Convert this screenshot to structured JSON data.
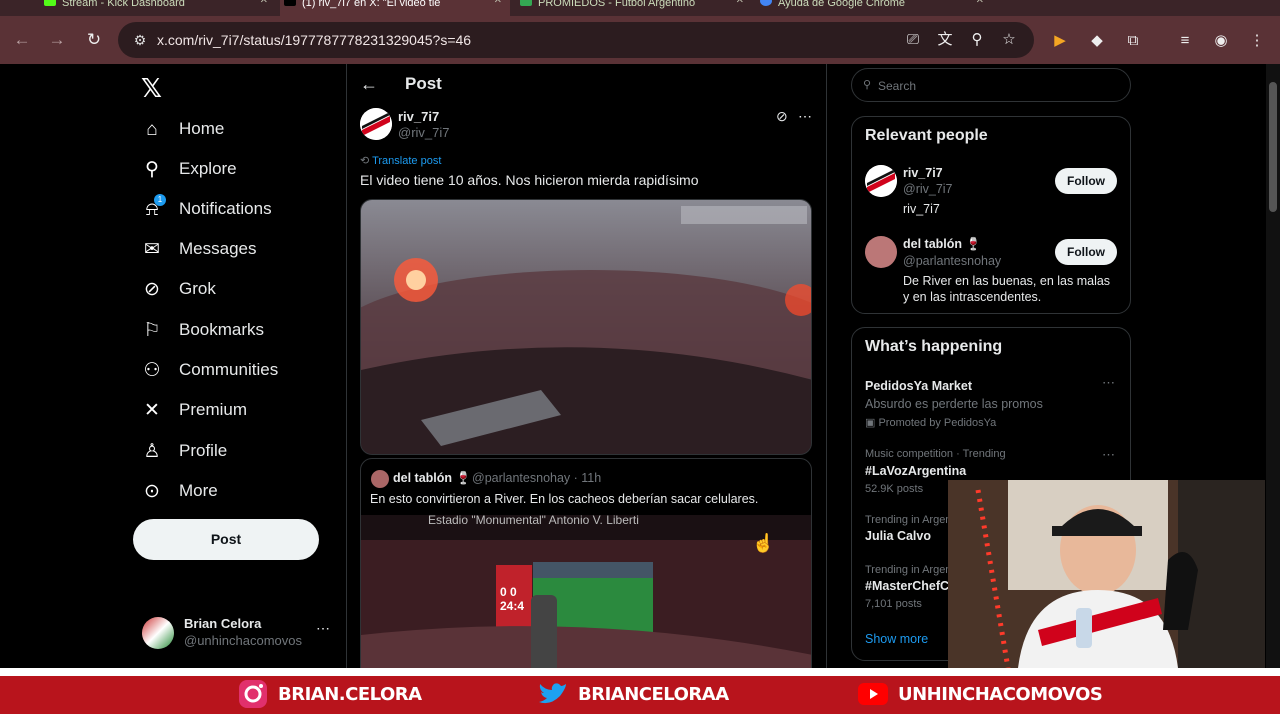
{
  "browser": {
    "tabs": [
      {
        "title": "Stream - Kick Dashboard",
        "color": "#53fc18"
      },
      {
        "title": "(1) riv_7i7 en X: \"El video tie",
        "color": "#ffffff"
      },
      {
        "title": "PROMIEDOS - Fútbol Argentino",
        "color": "#34a853"
      },
      {
        "title": "Ayuda de Google Chrome",
        "color": "#4285f4"
      }
    ],
    "url": "x.com/riv_7i7/status/1977787778231329045?s=46"
  },
  "sidebar": {
    "items": [
      {
        "label": "Home",
        "icon": "home-icon",
        "glyph": "⌂"
      },
      {
        "label": "Explore",
        "icon": "search-icon",
        "glyph": "⚲"
      },
      {
        "label": "Notifications",
        "icon": "bell-icon",
        "glyph": "🔔",
        "badge": "1"
      },
      {
        "label": "Messages",
        "icon": "envelope-icon",
        "glyph": "✉"
      },
      {
        "label": "Grok",
        "icon": "grok-icon",
        "glyph": "⊘"
      },
      {
        "label": "Bookmarks",
        "icon": "bookmark-icon",
        "glyph": "⚑"
      },
      {
        "label": "Communities",
        "icon": "people-icon",
        "glyph": "👥"
      },
      {
        "label": "Premium",
        "icon": "x-icon",
        "glyph": "𝕏"
      },
      {
        "label": "Profile",
        "icon": "person-icon",
        "glyph": "👤"
      },
      {
        "label": "More",
        "icon": "more-circle-icon",
        "glyph": "⋯"
      }
    ],
    "post_button": "Post",
    "account": {
      "name": "Brian Celora",
      "handle": "@unhinchacomovos"
    }
  },
  "main": {
    "header": "Post",
    "author": {
      "name": "riv_7i7",
      "handle": "@riv_7i7"
    },
    "translate": "Translate post",
    "text": "El video tiene 10 años. Nos hicieron mierda rapidísimo",
    "quote": {
      "name": "del tablón 🍷",
      "handle": "@parlantesnohay · 11h",
      "text": "En esto convirtieron a River. En los cacheos deberían sacar celulares.",
      "media_caption": "Estadio \"Monumental\" Antonio V. Liberti",
      "scoreboard": "0 0\n24:4"
    }
  },
  "right": {
    "search_placeholder": "Search",
    "relevant_title": "Relevant people",
    "people": [
      {
        "name": "riv_7i7",
        "handle": "@riv_7i7",
        "bio": "riv_7i7",
        "follow": "Follow"
      },
      {
        "name": "del tablón 🍷",
        "handle": "@parlantesnohay",
        "bio": "De River en las buenas, en las malas y en las intrascendentes.",
        "follow": "Follow"
      }
    ],
    "happening_title": "What’s happening",
    "trends": [
      {
        "meta": "",
        "title": "PedidosYa Market",
        "sub": "Absurdo es perderte las promos",
        "promo": "Promoted by PedidosYa"
      },
      {
        "meta": "Music competition · Trending",
        "title": "#LaVozArgentina",
        "sub": "52.9K posts"
      },
      {
        "meta": "Trending in Argent",
        "title": "Julia Calvo",
        "sub": ""
      },
      {
        "meta": "Trending in Argent",
        "title": "#MasterChefC",
        "sub": "7,101 posts"
      }
    ],
    "show_more": "Show more"
  },
  "overlay": {
    "socials": [
      {
        "icon": "instagram-icon",
        "handle": "BRIAN.CELORA"
      },
      {
        "icon": "twitter-icon",
        "handle": "BRIANCELORAA"
      },
      {
        "icon": "youtube-icon",
        "handle": "UNHINCHACOMOVOS"
      }
    ]
  }
}
